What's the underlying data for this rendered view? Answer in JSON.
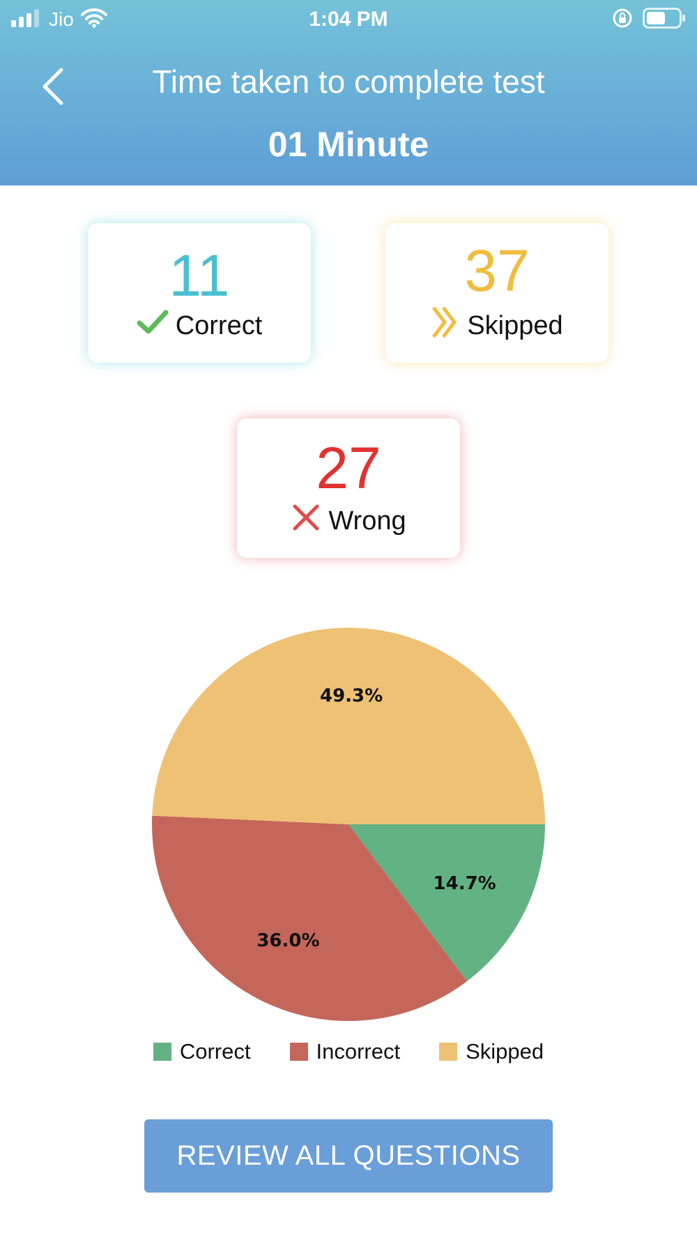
{
  "status_bar": {
    "carrier": "Jio",
    "time": "1:04 PM"
  },
  "header": {
    "title": "Time taken to complete test",
    "duration": "01 Minute"
  },
  "stats": {
    "correct": {
      "count": "11",
      "label": "Correct",
      "color": "#4bbfd0"
    },
    "skipped": {
      "count": "37",
      "label": "Skipped",
      "color": "#f1bd3e"
    },
    "wrong": {
      "count": "27",
      "label": "Wrong",
      "color": "#e2312f"
    }
  },
  "chart_data": {
    "type": "pie",
    "title": "",
    "slices": [
      {
        "label": "Correct",
        "value": 14.7,
        "display": "14.7%",
        "color": "#63b283"
      },
      {
        "label": "Incorrect",
        "value": 36.0,
        "display": "36.0%",
        "color": "#c5665a"
      },
      {
        "label": "Skipped",
        "value": 49.3,
        "display": "49.3%",
        "color": "#eec174"
      }
    ],
    "legend_position": "bottom"
  },
  "actions": {
    "review_label": "REVIEW ALL QUESTIONS"
  }
}
